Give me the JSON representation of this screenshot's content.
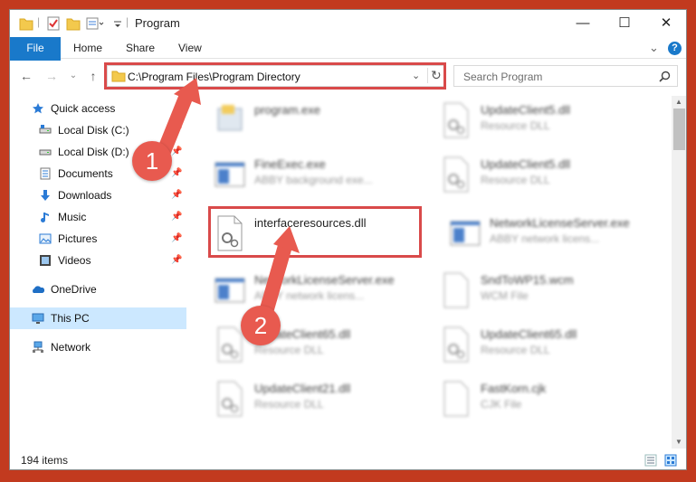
{
  "window": {
    "title": "Program",
    "minimize": "—",
    "maximize": "☐",
    "close": "✕"
  },
  "ribbon": {
    "tabs": [
      "File",
      "Home",
      "Share",
      "View"
    ],
    "help": "?",
    "expand": "⌄"
  },
  "address": {
    "path": "C:\\Program Files\\Program Directory",
    "search_placeholder": "Search Program"
  },
  "navigation": {
    "quick_access": "Quick access",
    "items": [
      {
        "label": "Local Disk (C:)",
        "icon": "drive-icon"
      },
      {
        "label": "Local Disk (D:)",
        "icon": "drive-icon"
      },
      {
        "label": "Documents",
        "icon": "documents-icon"
      },
      {
        "label": "Downloads",
        "icon": "downloads-icon"
      },
      {
        "label": "Music",
        "icon": "music-icon"
      },
      {
        "label": "Pictures",
        "icon": "pictures-icon"
      },
      {
        "label": "Videos",
        "icon": "videos-icon"
      }
    ],
    "onedrive": "OneDrive",
    "this_pc": "This PC",
    "network": "Network"
  },
  "files": [
    {
      "name": "program.exe",
      "type": "",
      "icon": "exe-icon"
    },
    {
      "name": "UpdateClient5.dll",
      "type": "Resource DLL",
      "icon": "dll-icon"
    },
    {
      "name": "FineExec.exe",
      "type": "ABBY background exe...",
      "icon": "window-icon"
    },
    {
      "name": "UpdateClient5.dll",
      "type": "Resource DLL",
      "icon": "dll-icon"
    },
    {
      "name": "interfaceresources.dll",
      "type": "",
      "icon": "dll-icon"
    },
    {
      "name": "NetworkLicenseServer.exe",
      "type": "ABBY network licens...",
      "icon": "window-icon"
    },
    {
      "name": "NetworkLicenseServer.exe",
      "type": "ABBY network licens...",
      "icon": "window-icon"
    },
    {
      "name": "SndToWP15.wcm",
      "type": "WCM File",
      "icon": "blank-file-icon"
    },
    {
      "name": "UpdateClient65.dll",
      "type": "Resource DLL",
      "icon": "dll-icon"
    },
    {
      "name": "UpdateClient65.dll",
      "type": "Resource DLL",
      "icon": "dll-icon"
    },
    {
      "name": "UpdateClient21.dll",
      "type": "Resource DLL",
      "icon": "dll-icon"
    },
    {
      "name": "FastKorn.cjk",
      "type": "CJK File",
      "icon": "blank-file-icon"
    }
  ],
  "status": {
    "item_count": "194 items"
  },
  "annotations": {
    "step1": "1",
    "step2": "2"
  },
  "colors": {
    "accent": "#1979ca",
    "highlight": "#d94a4a",
    "selected": "#cce8ff"
  }
}
